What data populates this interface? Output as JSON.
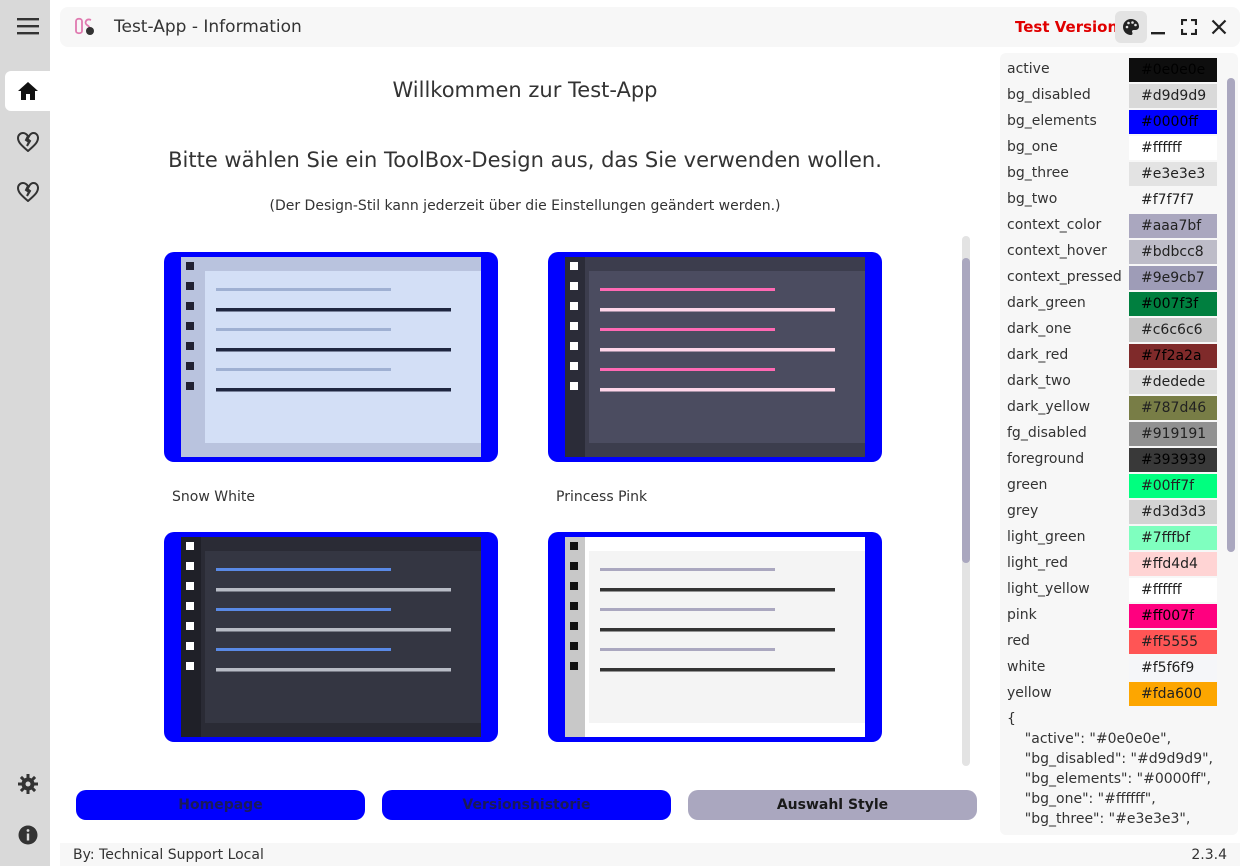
{
  "window": {
    "title": "Test-App - Information",
    "test_version": "Test Version"
  },
  "sidebar": {
    "items": [
      {
        "icon": "menu-icon"
      },
      {
        "icon": "home-icon",
        "active": true
      },
      {
        "icon": "heart-broken-icon"
      },
      {
        "icon": "heart-broken-icon"
      },
      {
        "icon": "gear-icon"
      },
      {
        "icon": "info-icon"
      }
    ]
  },
  "main": {
    "welcome": "Willkommen zur Test-App",
    "subtitle": "Bitte wählen Sie ein ToolBox-Design aus, das Sie verwenden wollen.",
    "note": "(Der Design-Stil kann jederzeit über die Einstellungen geändert werden.)",
    "designs": [
      {
        "label": "Snow White",
        "bar": "#b9c3de",
        "bg": "#d3dff6",
        "frame": "#b9c3de",
        "line_a": "#9fb0d2",
        "line_b": "#1f2640",
        "dots": "#222233"
      },
      {
        "label": "Princess Pink",
        "bar": "#2b2c38",
        "bg": "#4b4c60",
        "frame": "#3c3d4d",
        "line_a": "#ff69b4",
        "line_b": "#ffd6ea",
        "dots": "#ffffff"
      },
      {
        "label": "",
        "bar": "#1f2028",
        "bg": "#343642",
        "frame": "#2a2b35",
        "line_a": "#5a8ae6",
        "line_b": "#b8bcc6",
        "dots": "#ffffff"
      },
      {
        "label": "",
        "bar": "#c8c8c8",
        "bg": "#f4f4f4",
        "frame": "#ffffff",
        "line_a": "#aaa7bf",
        "line_b": "#333333",
        "dots": "#111111"
      }
    ],
    "buttons": {
      "homepage": "Homepage",
      "version_history": "Versionshistorie",
      "select_style": "Auswahl Style"
    }
  },
  "colors": [
    {
      "name": "active",
      "hex": "#0e0e0e"
    },
    {
      "name": "bg_disabled",
      "hex": "#d9d9d9"
    },
    {
      "name": "bg_elements",
      "hex": "#0000ff"
    },
    {
      "name": "bg_one",
      "hex": "#ffffff"
    },
    {
      "name": "bg_three",
      "hex": "#e3e3e3"
    },
    {
      "name": "bg_two",
      "hex": "#f7f7f7"
    },
    {
      "name": "context_color",
      "hex": "#aaa7bf"
    },
    {
      "name": "context_hover",
      "hex": "#bdbcc8"
    },
    {
      "name": "context_pressed",
      "hex": "#9e9cb7"
    },
    {
      "name": "dark_green",
      "hex": "#007f3f"
    },
    {
      "name": "dark_one",
      "hex": "#c6c6c6"
    },
    {
      "name": "dark_red",
      "hex": "#7f2a2a"
    },
    {
      "name": "dark_two",
      "hex": "#dedede"
    },
    {
      "name": "dark_yellow",
      "hex": "#787d46"
    },
    {
      "name": "fg_disabled",
      "hex": "#919191"
    },
    {
      "name": "foreground",
      "hex": "#393939"
    },
    {
      "name": "green",
      "hex": "#00ff7f"
    },
    {
      "name": "grey",
      "hex": "#d3d3d3"
    },
    {
      "name": "light_green",
      "hex": "#7fffbf"
    },
    {
      "name": "light_red",
      "hex": "#ffd4d4"
    },
    {
      "name": "light_yellow",
      "hex": "#ffffff"
    },
    {
      "name": "pink",
      "hex": "#ff007f"
    },
    {
      "name": "red",
      "hex": "#ff5555"
    },
    {
      "name": "white",
      "hex": "#f5f6f9"
    },
    {
      "name": "yellow",
      "hex": "#fda600"
    }
  ],
  "json_preview": [
    "{",
    "    \"active\": \"#0e0e0e\",",
    "    \"bg_disabled\": \"#d9d9d9\",",
    "    \"bg_elements\": \"#0000ff\",",
    "    \"bg_one\": \"#ffffff\",",
    "    \"bg_three\": \"#e3e3e3\","
  ],
  "footer": {
    "left": "By: Technical Support Local",
    "right": "2.3.4"
  }
}
